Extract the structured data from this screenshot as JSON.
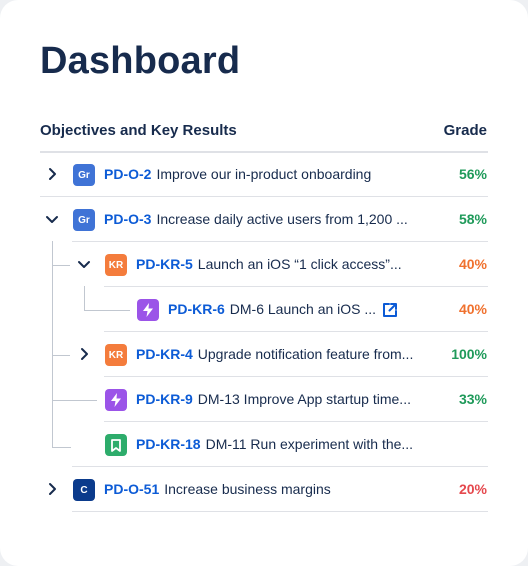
{
  "title": "Dashboard",
  "header": {
    "left": "Objectives and Key Results",
    "right": "Grade"
  },
  "rows": [
    {
      "badge": "Gr",
      "key": "PD-O-2",
      "text": "Improve our in-product onboarding",
      "grade": "56%",
      "grade_color": "#1f9a5a",
      "badge_color": "#3f73d6",
      "chevron": "right"
    },
    {
      "badge": "Gr",
      "key": "PD-O-3",
      "text": "Increase daily active users from 1,200 ...",
      "grade": "58%",
      "grade_color": "#1f9a5a",
      "badge_color": "#3f73d6",
      "chevron": "down"
    },
    {
      "badge": "KR",
      "key": "PD-KR-5",
      "text": "Launch an iOS “1 click access”...",
      "grade": "40%",
      "grade_color": "#f0712e",
      "badge_color": "#f47c3c",
      "chevron": "down"
    },
    {
      "badge": "bolt-icon",
      "key": "PD-KR-6",
      "text": "DM-6 Launch an iOS ...",
      "grade": "40%",
      "grade_color": "#f0712e",
      "badge_color": "#9b54e8",
      "chevron": "none",
      "external_link": "external-link-icon"
    },
    {
      "badge": "KR",
      "key": "PD-KR-4",
      "text": "Upgrade notification feature from...",
      "grade": "100%",
      "grade_color": "#1f9a5a",
      "badge_color": "#f47c3c",
      "chevron": "right"
    },
    {
      "badge": "bolt-icon",
      "key": "PD-KR-9",
      "text": "DM-13 Improve App startup time...",
      "grade": "33%",
      "grade_color": "#1f9a5a",
      "badge_color": "#9b54e8",
      "chevron": "none"
    },
    {
      "badge": "bookmark-icon",
      "key": "PD-KR-18",
      "text": "DM-11 Run experiment with the...",
      "grade": "",
      "grade_color": "#1f9a5a",
      "badge_color": "#2dac6b",
      "chevron": "none"
    },
    {
      "badge": "C",
      "key": "PD-O-51",
      "text": "Increase business margins",
      "grade": "20%",
      "grade_color": "#e5484d",
      "badge_color": "#0b3b8c",
      "chevron": "right"
    }
  ]
}
